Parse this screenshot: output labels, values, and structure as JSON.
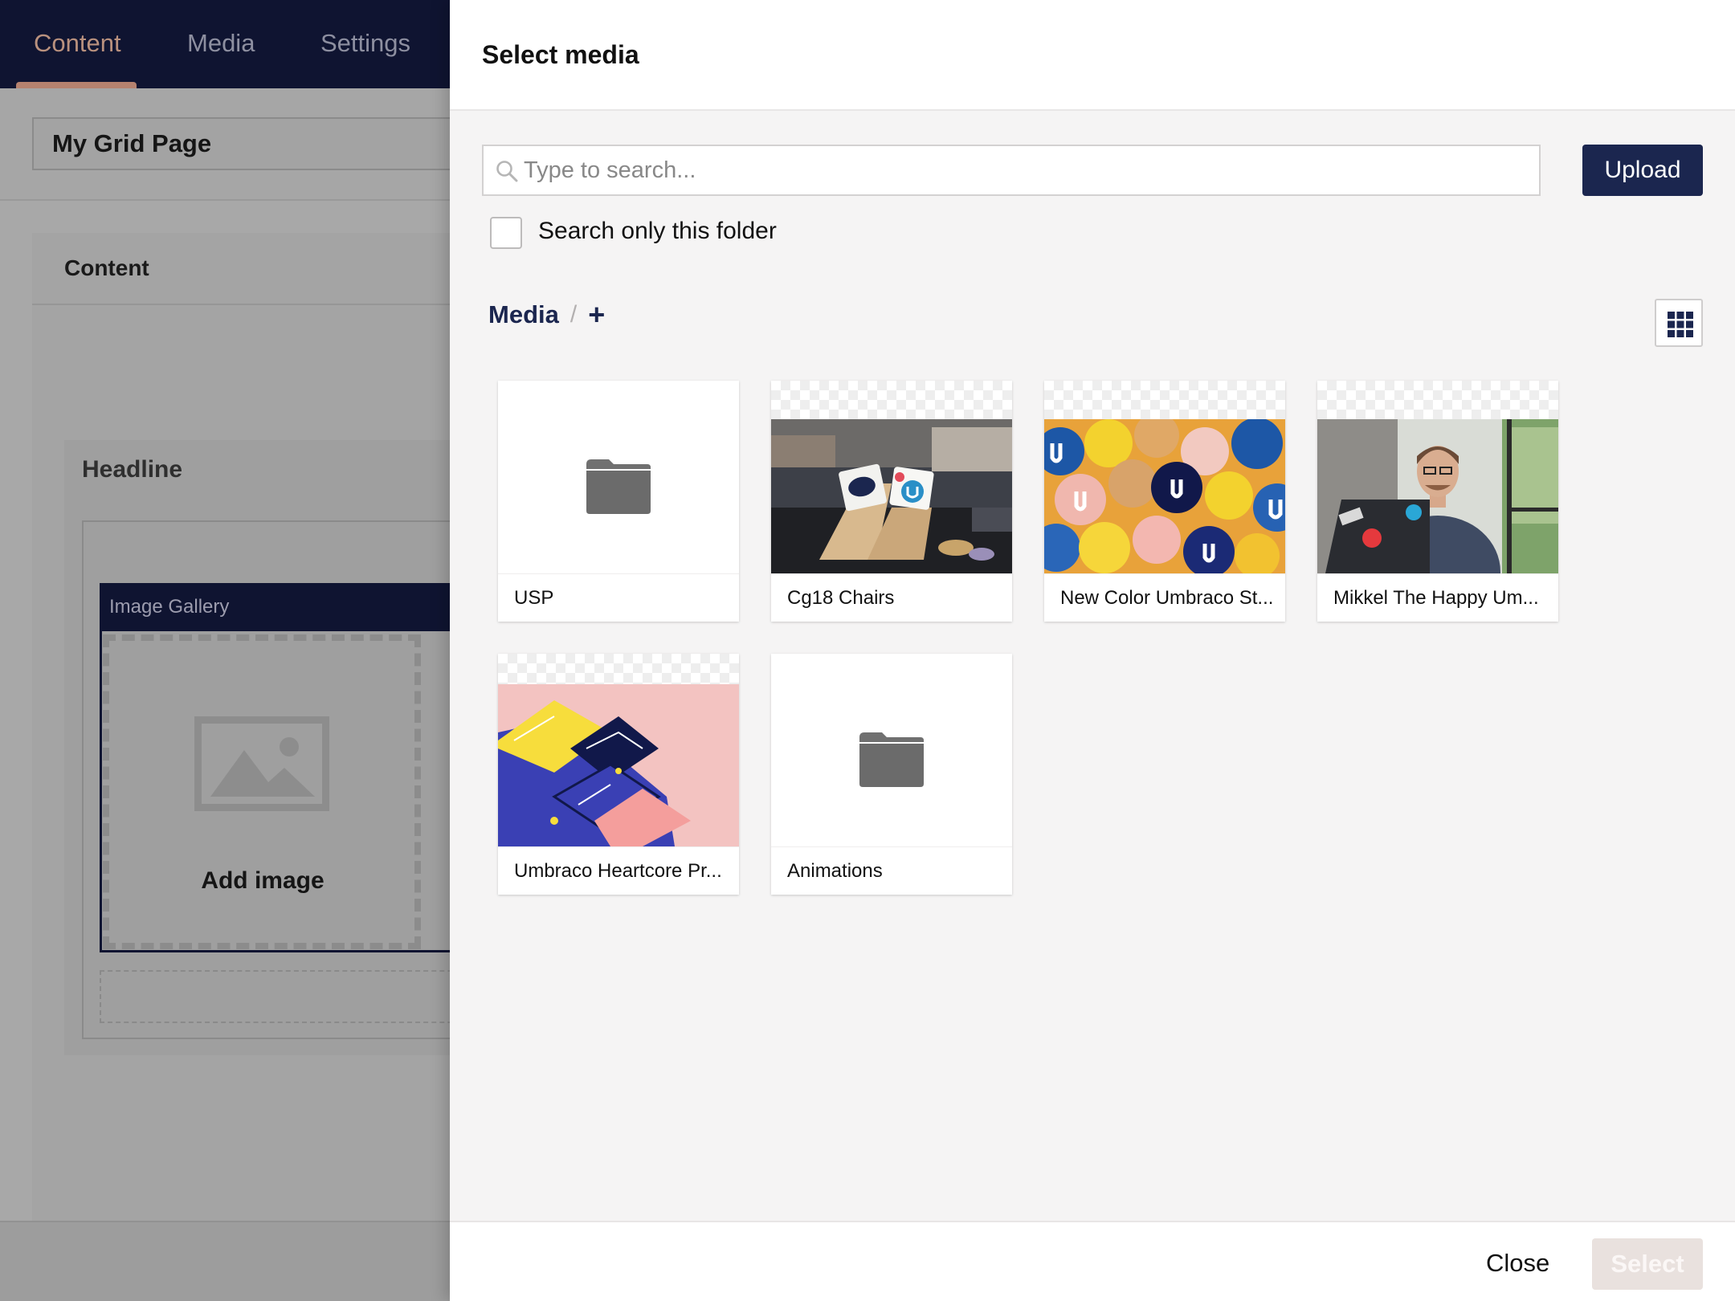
{
  "topnav": {
    "items": [
      {
        "label": "Content",
        "active": true
      },
      {
        "label": "Media"
      },
      {
        "label": "Settings"
      }
    ]
  },
  "editor": {
    "page_title": "My Grid Page",
    "tab_label": "Content",
    "headline_label": "Headline",
    "gallery_label": "Image Gallery",
    "add_image_label": "Add image"
  },
  "dialog": {
    "title": "Select media",
    "search": {
      "placeholder": "Type to search...",
      "value": ""
    },
    "upload_label": "Upload",
    "search_folder_label": "Search only this folder",
    "search_folder_checked": false,
    "breadcrumb": {
      "root": "Media",
      "separator": "/",
      "add": "+"
    },
    "view_toggle_icon": "grid-icon",
    "items": [
      {
        "name": "USP",
        "type": "folder"
      },
      {
        "name": "Cg18 Chairs",
        "type": "image"
      },
      {
        "name": "New Color Umbraco St...",
        "type": "image"
      },
      {
        "name": "Mikkel The Happy Um...",
        "type": "image"
      },
      {
        "name": "Umbraco Heartcore Pr...",
        "type": "image"
      },
      {
        "name": "Animations",
        "type": "folder"
      }
    ],
    "close_label": "Close",
    "select_label": "Select"
  },
  "colors": {
    "brand_navy": "#1b264f",
    "topbar": "#0f1431",
    "active_nav": "#b5826f",
    "select_disabled": "#e9e1de"
  }
}
